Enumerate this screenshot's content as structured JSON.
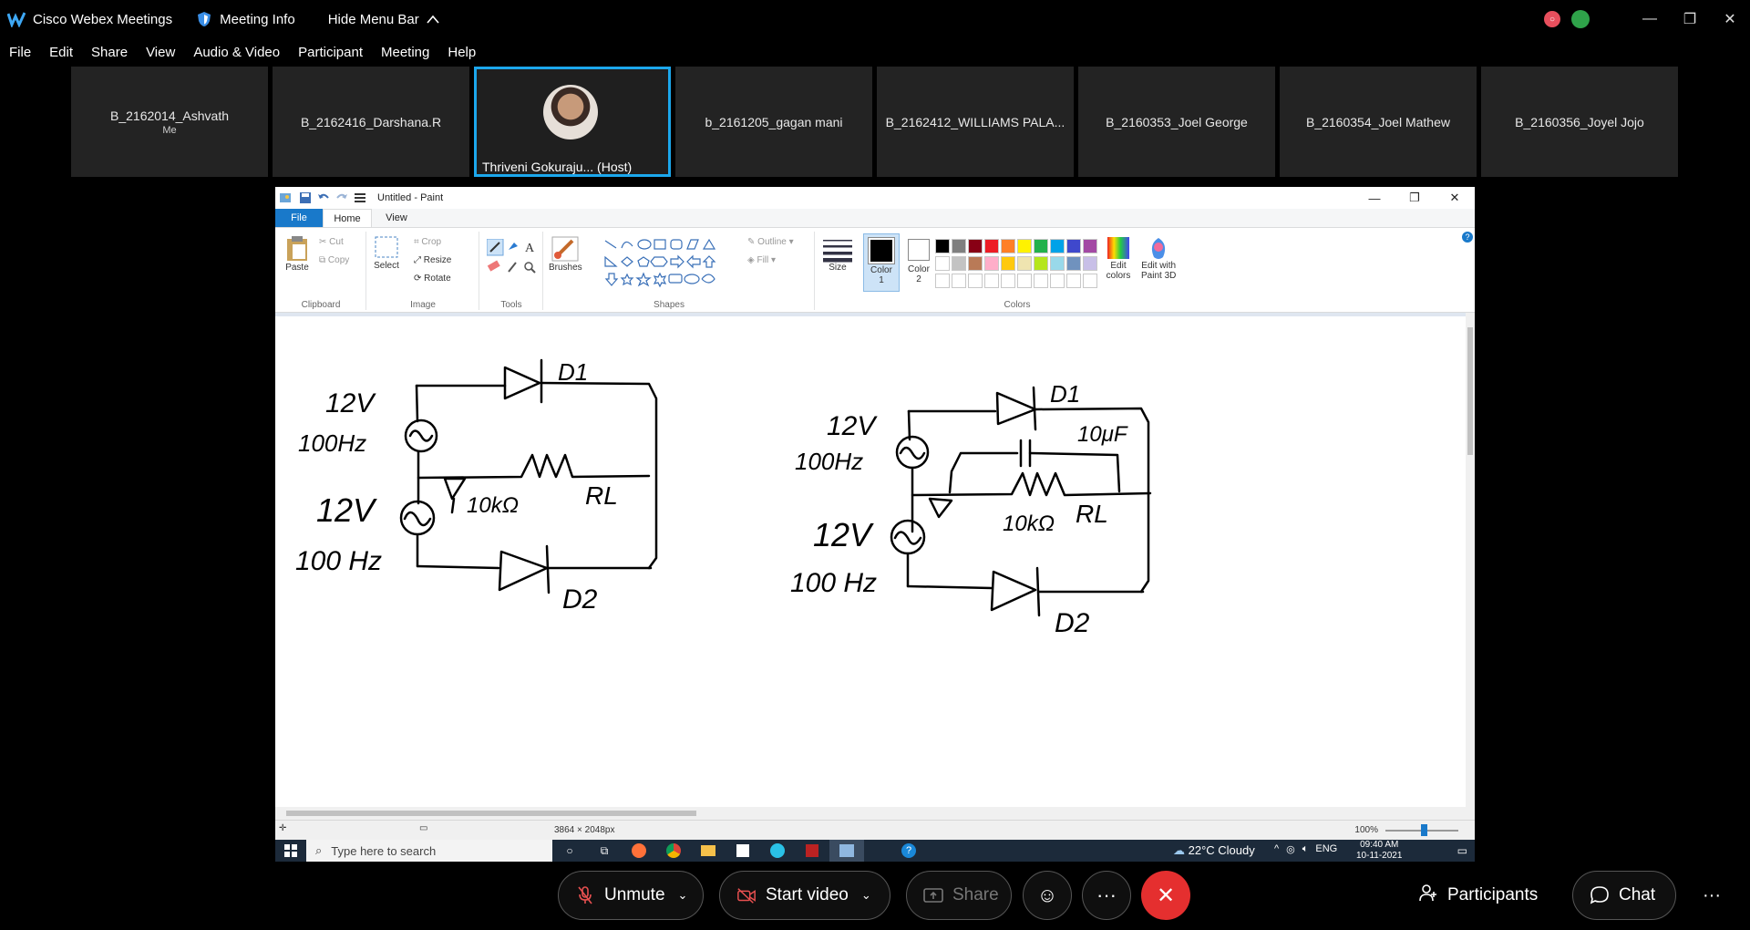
{
  "topbar": {
    "app_title": "Cisco Webex Meetings",
    "meeting_info": "Meeting Info",
    "hide_menu": "Hide Menu Bar"
  },
  "menu": [
    "File",
    "Edit",
    "Share",
    "View",
    "Audio & Video",
    "Participant",
    "Meeting",
    "Help"
  ],
  "participants": [
    {
      "name": "B_2162014_Ashvath",
      "sub": "Me"
    },
    {
      "name": "B_2162416_Darshana.R",
      "sub": ""
    },
    {
      "name": "Thriveni Gokuraju...   (Host)",
      "sub": "",
      "host": true
    },
    {
      "name": "b_2161205_gagan mani",
      "sub": ""
    },
    {
      "name": "B_2162412_WILLIAMS PALA...",
      "sub": ""
    },
    {
      "name": "B_2160353_Joel George",
      "sub": ""
    },
    {
      "name": "B_2160354_Joel Mathew",
      "sub": ""
    },
    {
      "name": "B_2160356_Joyel Jojo",
      "sub": ""
    }
  ],
  "paint": {
    "title": "Untitled - Paint",
    "tabs": {
      "file": "File",
      "home": "Home",
      "view": "View"
    },
    "ribbon": {
      "paste": "Paste",
      "cut": "Cut",
      "copy": "Copy",
      "select": "Select",
      "crop": "Crop",
      "resize": "Resize",
      "rotate": "Rotate",
      "brushes": "Brushes",
      "outline": "Outline",
      "fill": "Fill",
      "size": "Size",
      "color1": "Color\n1",
      "color2": "Color\n2",
      "edit_colors": "Edit\ncolors",
      "edit_paint3d": "Edit with\nPaint 3D",
      "groups": {
        "clipboard": "Clipboard",
        "image": "Image",
        "tools": "Tools",
        "shapes": "Shapes",
        "colors": "Colors"
      }
    },
    "palette": [
      "#000000",
      "#7f7f7f",
      "#880015",
      "#ed1c24",
      "#ff7f27",
      "#fff200",
      "#22b14c",
      "#00a2e8",
      "#3f48cc",
      "#a349a4",
      "#ffffff",
      "#c3c3c3",
      "#b97a57",
      "#ffaec9",
      "#ffc90e",
      "#efe4b0",
      "#b5e61d",
      "#99d9ea",
      "#7092be",
      "#c8bfe7"
    ],
    "status": {
      "dimensions": "3864 × 2048px",
      "zoom": "100%"
    },
    "drawing": {
      "left": {
        "label_v1": "12V",
        "label_f1": "100Hz",
        "label_v2": "12V",
        "label_f2": "100 Hz",
        "d1": "D1",
        "d2": "D2",
        "rl_value": "10kΩ",
        "rl": "RL"
      },
      "right": {
        "label_v1": "12V",
        "label_f1": "100Hz",
        "label_v2": "12V",
        "label_f2": "100 Hz",
        "d1": "D1",
        "d2": "D2",
        "c_value": "10μF",
        "rl_value": "10kΩ",
        "rl": "RL"
      }
    }
  },
  "taskbar": {
    "search_placeholder": "Type here to search",
    "weather": "22°C  Cloudy",
    "lang": "ENG",
    "time": "09:40 AM",
    "date": "10-11-2021"
  },
  "controls": {
    "unmute": "Unmute",
    "start_video": "Start video",
    "share": "Share",
    "participants": "Participants",
    "chat": "Chat"
  },
  "colors": {
    "accent": "#1ca7ec",
    "end_call": "#e52f2f",
    "paint_file_tab": "#1979ca"
  }
}
